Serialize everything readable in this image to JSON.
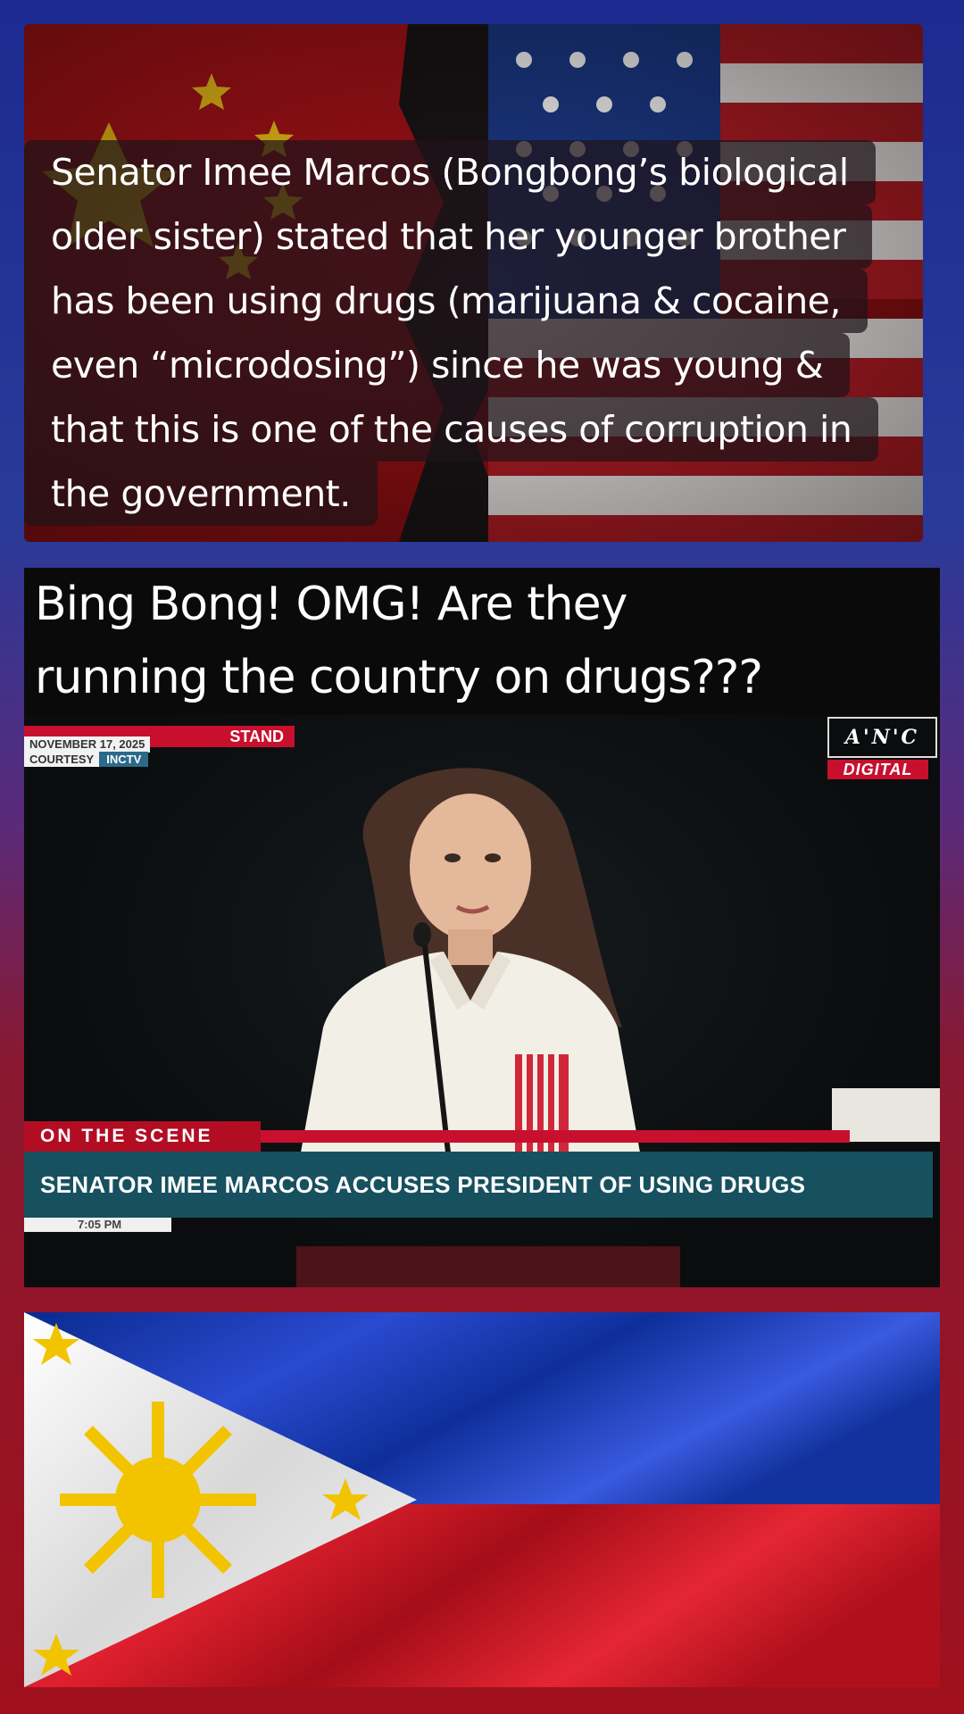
{
  "caption": {
    "lines": [
      "Senator Imee Marcos (Bongbong’s biological",
      "older sister) stated that her younger brother",
      "has been using drugs (marijuana & cocaine,",
      "even “microdosing”) since he was young &",
      "that this is one of the causes of corruption in",
      "the government."
    ]
  },
  "video": {
    "title_lines": [
      "Bing Bong! OMG! Are they",
      "running the country on drugs???"
    ],
    "broadcast": {
      "program": "STAND",
      "date": "NOVEMBER 17, 2025",
      "courtesy_key": "COURTESY",
      "courtesy_value": "INCTV",
      "network_logo": "A'N'C",
      "network_sub": "DIGITAL",
      "segment_label": "ON THE SCENE",
      "headline": "SENATOR IMEE MARCOS ACCUSES PRESIDENT OF USING DRUGS",
      "time": "7:05 PM"
    }
  },
  "colors": {
    "bg_top": "#1d2a8f",
    "bg_bottom": "#a0101c",
    "news_red": "#c8102e",
    "news_teal": "#17505f"
  },
  "icons": {
    "flags_top": [
      "china-flag",
      "usa-flag"
    ],
    "flag_bottom": "philippines-flag"
  }
}
